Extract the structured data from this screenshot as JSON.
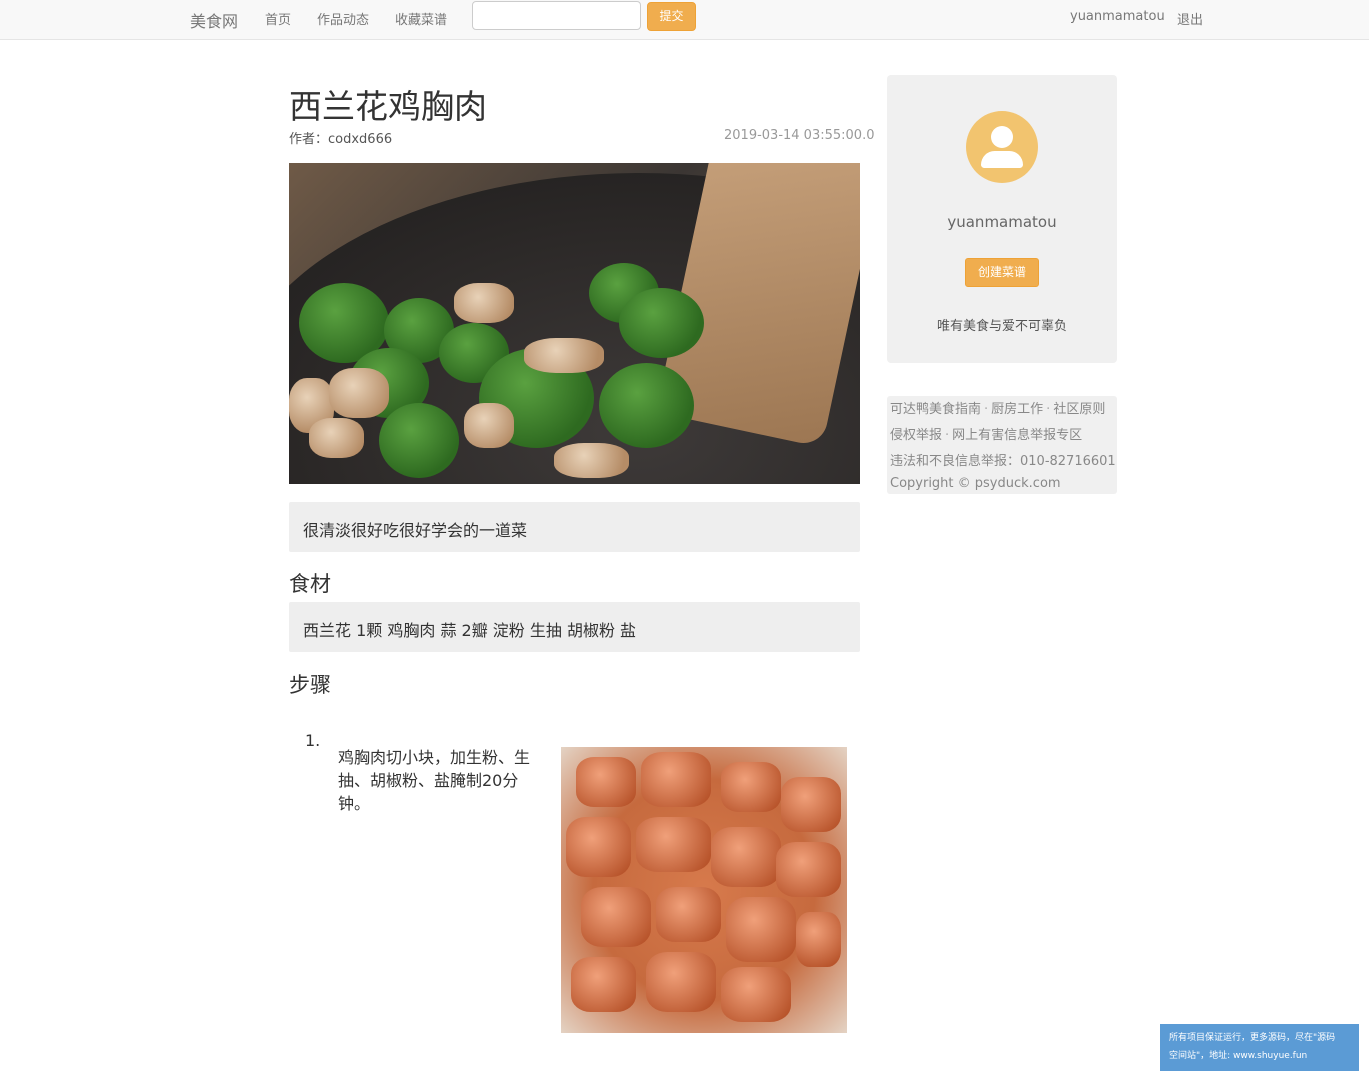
{
  "navbar": {
    "brand": "美食网",
    "links": [
      "首页",
      "作品动态",
      "收藏菜谱"
    ],
    "search_value": "",
    "submit_label": "提交",
    "username": "yuanmamatou",
    "logout_label": "退出"
  },
  "recipe": {
    "title": "西兰花鸡胸肉",
    "author": "作者：codxd666",
    "date": "2019-03-14 03:55:00.0",
    "description": "很清淡很好吃很好学会的一道菜",
    "ingredients_heading": "食材",
    "ingredients": "西兰花 1颗 鸡胸肉 蒜 2瓣 淀粉 生抽 胡椒粉 盐",
    "steps_heading": "步骤",
    "steps": [
      {
        "number": "1.",
        "text": "鸡胸肉切小块，加生粉、生抽、胡椒粉、盐腌制20分钟。"
      }
    ]
  },
  "sidebar": {
    "username": "yuanmamatou",
    "create_label": "创建菜谱",
    "motto": "唯有美食与爱不可辜负"
  },
  "footer": {
    "line1": [
      "可达鸭美食指南",
      "厨房工作",
      "社区原则"
    ],
    "line2": [
      "侵权举报",
      "网上有害信息举报专区"
    ],
    "line3": "违法和不良信息举报：010-82716601",
    "line4": "Copyright © psyduck.com"
  },
  "banner": {
    "line1": "所有项目保证运行，更多源码，尽在\"源码",
    "line2": "空间站\"，地址: www.shuyue.fun"
  },
  "colors": {
    "accent": "#f0ad4e",
    "navbar_bg": "#f8f8f8",
    "panel_bg": "#eeeeee",
    "banner_bg": "#5b9bd5"
  },
  "icons": {
    "avatar": "user-icon"
  }
}
